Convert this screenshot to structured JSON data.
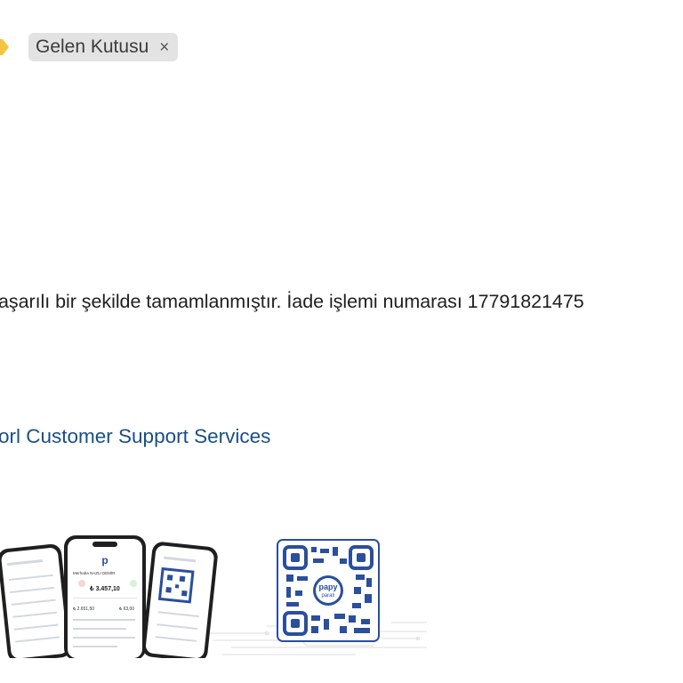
{
  "label": {
    "icon": "label-tag-icon",
    "icon_color": "#f5c542",
    "tag_text": "Gelen Kutusu",
    "close_glyph": "×"
  },
  "email": {
    "body_line": "aşarılı bir şekilde tamamlanmıştır. İade işlemi numarası 17791821475",
    "signature": "orl Customer Support Services"
  },
  "promo": {
    "center_phone_amount": "₺ 3.457,10",
    "center_phone_greeting": "Merhaba NAZLI DEMİR",
    "center_phone_small_1": "₺ 2.651,50",
    "center_phone_small_2": "₺ 63,00",
    "qr_logo_line1": "papy",
    "qr_logo_line2": "paralı"
  },
  "colors": {
    "link": "#1a4f86",
    "qr_blue": "#2a4f9c"
  }
}
